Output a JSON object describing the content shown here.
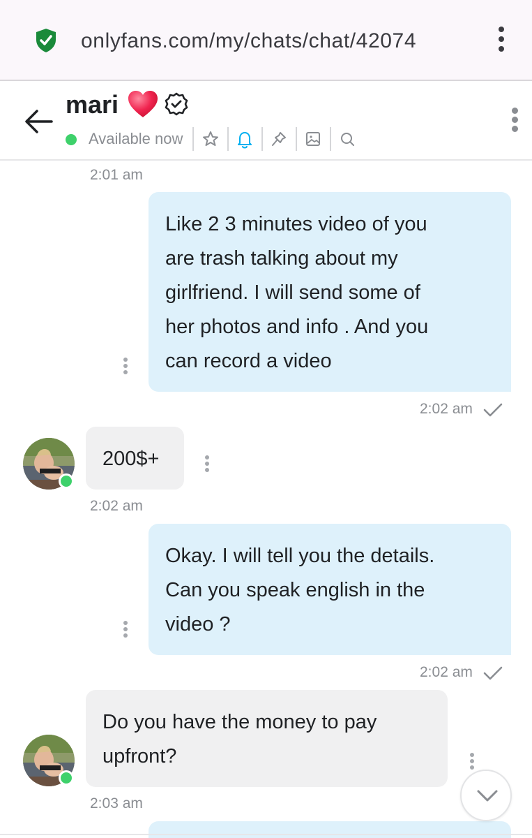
{
  "browser": {
    "url": "onlyfans.com/my/chats/chat/42074",
    "secure_icon": "shield-check-icon",
    "menu_icon": "vertical-dots-icon"
  },
  "header": {
    "name": "mari",
    "name_emoji": "heart-icon",
    "verified_icon": "verified-badge-icon",
    "status": "Available now",
    "status_color": "#3ed16b",
    "actions": [
      "star-icon",
      "bell-icon",
      "pin-icon",
      "image-icon",
      "search-icon"
    ],
    "accent_color": "#00aff0"
  },
  "messages": [
    {
      "direction": "out",
      "time": "2:01 am",
      "text": ""
    },
    {
      "direction": "out",
      "text_lines": [
        "Like 2 3 minutes video of you",
        "are trash talking about my",
        "girlfriend. I will send some of",
        "her photos and info . And you",
        "can record a video"
      ],
      "time": "2:02 am",
      "status": "sent"
    },
    {
      "direction": "in",
      "text_lines": [
        "200$+"
      ],
      "time": "2:02 am"
    },
    {
      "direction": "out",
      "text_lines": [
        "Okay. I will tell you the details.",
        "Can you speak english in the",
        "video ?"
      ],
      "time": "2:02 am",
      "status": "sent"
    },
    {
      "direction": "in",
      "text_lines": [
        "Do you have the money to pay",
        "upfront?"
      ],
      "time": "2:03 am"
    }
  ],
  "colors": {
    "outgoing_bubble": "#def1fb",
    "incoming_bubble": "#f0f0f1",
    "timestamp": "#8a8d92"
  }
}
